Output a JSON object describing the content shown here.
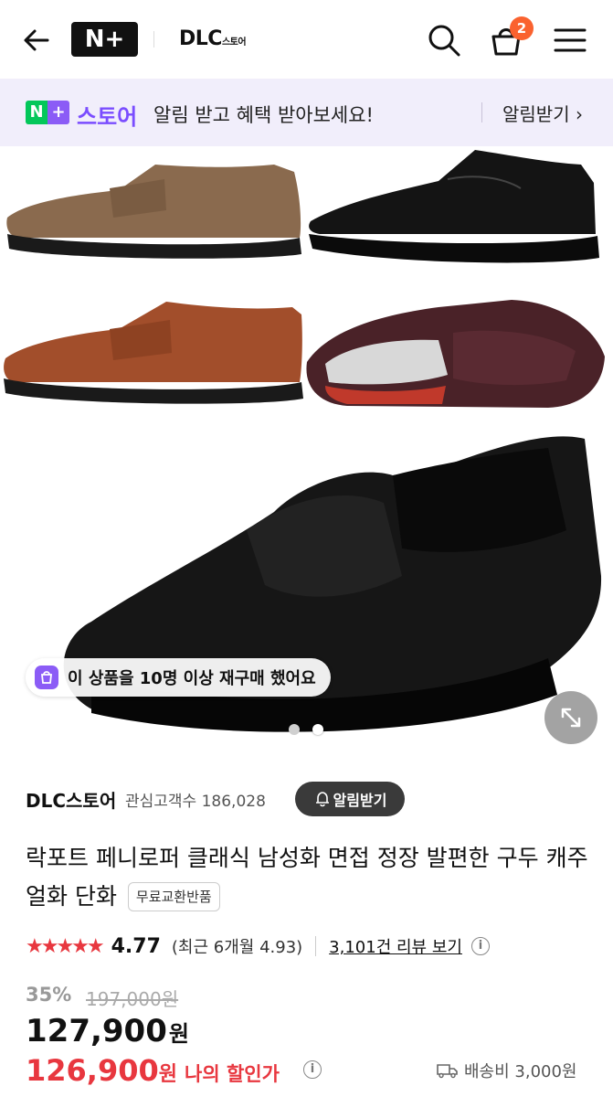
{
  "header": {
    "logo_text": "N+",
    "brand_name": "DLC",
    "brand_suffix": "스토어",
    "cart_count": "2"
  },
  "banner": {
    "logo_mark": "N+",
    "store_label": "스토어",
    "message": "알림 받고 혜택 받아보세요!",
    "action_label": "알림받기 ›"
  },
  "gallery": {
    "repurchase_text": "이 상품을 10명 이상 재구매 했어요",
    "slide_count": 2,
    "active_slide": 2,
    "colors": {
      "brown": "#8a6a4e",
      "tan": "#a24e2b",
      "black": "#141414",
      "burgundy": "#4a2228"
    }
  },
  "seller": {
    "name": "DLC스토어",
    "stat": "관심고객수 186,028",
    "alarm_label": "알림받기"
  },
  "product": {
    "title": "락포트 페니로퍼 클래식 남성화 면접 정장 발편한 구두 캐주얼화 단화",
    "exchange_badge": "무료교환반품",
    "stars": "★★★★★",
    "rating": "4.77",
    "recent_rating": "(최근 6개월 4.93)",
    "reviews": "3,101건 리뷰 보기",
    "discount": "35%",
    "original_price": "197,000원",
    "price": "127,900",
    "price_unit": "원",
    "my_price": "126,900",
    "my_price_unit": "원",
    "my_price_label": "나의 할인가",
    "shipping": "배송비 3,000원"
  },
  "colors": {
    "accent_red": "#e8373f",
    "accent_purple": "#7a4dff",
    "naver_green": "#03c75a",
    "badge_orange": "#fa622f"
  }
}
